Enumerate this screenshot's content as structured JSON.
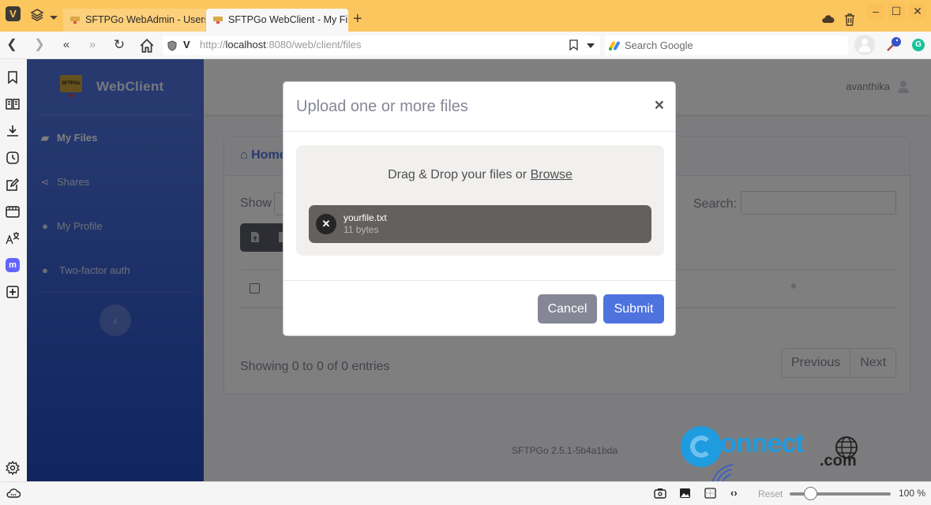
{
  "browser": {
    "tabs": [
      {
        "title": "SFTPGo WebAdmin - Users",
        "active": false
      },
      {
        "title": "SFTPGo WebClient - My Files",
        "active": true
      }
    ],
    "url": {
      "protocol": "http://",
      "host": "localhost",
      "rest": ":8080/web/client/files"
    },
    "search_placeholder": "Search Google",
    "status": {
      "reset_label": "Reset",
      "zoom_level": "100 %",
      "zoom_fraction": 0.2
    },
    "colors": {
      "tabbar": "#fcc65f"
    }
  },
  "app": {
    "brand": "WebClient",
    "logo_text": "SFTPGo",
    "sidebar": {
      "items": [
        {
          "label": "My Files",
          "icon": "folder-open-icon",
          "active": true
        },
        {
          "label": "Shares",
          "icon": "share-icon",
          "active": false
        },
        {
          "label": "My Profile",
          "icon": "user-icon",
          "active": false
        },
        {
          "label": "Two-factor auth",
          "icon": "user-lock-icon",
          "active": false
        }
      ],
      "toggle": "‹"
    },
    "topbar": {
      "username": "avanthika"
    },
    "card": {
      "breadcrumb_home": "Home",
      "show_label": "Show",
      "search_label": "Search:",
      "info": "Showing 0 to 0 of 0 entries",
      "pager": {
        "previous": "Previous",
        "next": "Next"
      }
    },
    "footer": "SFTPGo 2.5.1-5b4a1bda",
    "colors": {
      "primary": "#4e73df",
      "secondary": "#858796"
    }
  },
  "modal": {
    "title": "Upload one or more files",
    "close": "×",
    "dropzone": {
      "text": "Drag & Drop your files or ",
      "browse": "Browse"
    },
    "files": [
      {
        "name": "yourfile.txt",
        "size": "11 bytes"
      }
    ],
    "remove_glyph": "✕",
    "cancel_label": "Cancel",
    "submit_label": "Submit"
  },
  "watermark": {
    "text": "connect",
    "suffix": ".com"
  }
}
